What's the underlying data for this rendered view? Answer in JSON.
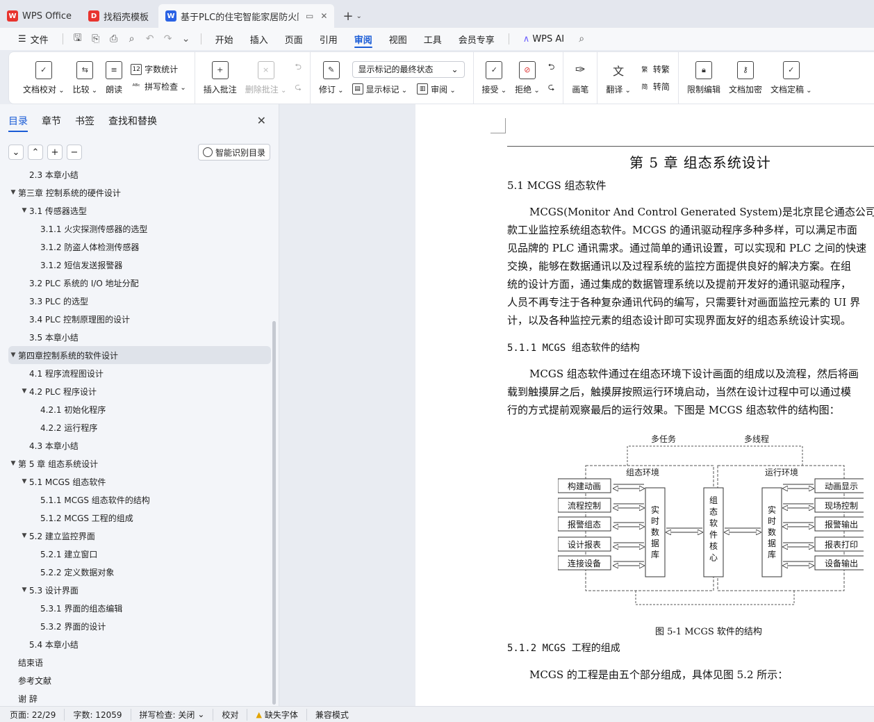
{
  "tabs": [
    {
      "label": "WPS Office",
      "icon": "wps-logo-icon",
      "color": "#e8342e"
    },
    {
      "label": "找稻壳模板",
      "icon": "docer-logo-icon",
      "color": "#e8342e"
    },
    {
      "label": "基于PLC的住宅智能家居防火防",
      "icon": "writer-logo-icon",
      "color": "#2a62e4"
    }
  ],
  "menu": {
    "file": "文件",
    "items": [
      "开始",
      "插入",
      "页面",
      "引用",
      "审阅",
      "视图",
      "工具",
      "会员专享"
    ],
    "active": "审阅",
    "wps_ai": "WPS AI"
  },
  "ribbon": {
    "doc_check": "文档校对",
    "compare": "比较",
    "read_aloud": "朗读",
    "word_count": "字数统计",
    "spell_check": "拼写检查",
    "insert_comment": "插入批注",
    "delete_comment": "删除批注",
    "revise": "修订",
    "markup_state": "显示标记的最终状态",
    "show_markup": "显示标记",
    "review": "审阅",
    "accept": "接受",
    "reject": "拒绝",
    "pen": "画笔",
    "translate": "翻译",
    "to_traditional": "转繁",
    "to_simplified": "转简",
    "restrict_edit": "限制编辑",
    "encrypt": "文档加密",
    "finalize": "文档定稿"
  },
  "sidebar": {
    "tabs": [
      "目录",
      "章节",
      "书签",
      "查找和替换"
    ],
    "active_tab": "目录",
    "smart_toc": "智能识别目录",
    "toc": [
      {
        "text": "2.3   本章小结",
        "level": 2,
        "arrow": ""
      },
      {
        "text": "第三章   控制系统的硬件设计",
        "level": 1,
        "arrow": "▼"
      },
      {
        "text": "3.1    传感器选型",
        "level": 2,
        "arrow": "▼"
      },
      {
        "text": "3.1.1    火灾探测传感器的选型",
        "level": 3,
        "arrow": ""
      },
      {
        "text": "3.1.2    防盗人体检测传感器",
        "level": 3,
        "arrow": ""
      },
      {
        "text": "3.1.2    短信发送报警器",
        "level": 3,
        "arrow": ""
      },
      {
        "text": "3.2    PLC 系统的 I/O 地址分配",
        "level": 2,
        "arrow": ""
      },
      {
        "text": "3.3    PLC 的选型",
        "level": 2,
        "arrow": ""
      },
      {
        "text": "3.4    PLC 控制原理图的设计",
        "level": 2,
        "arrow": ""
      },
      {
        "text": "3.5    本章小结",
        "level": 2,
        "arrow": ""
      },
      {
        "text": "第四章控制系统的软件设计",
        "level": 1,
        "arrow": "▼",
        "selected": true
      },
      {
        "text": "4.1  程序流程图设计",
        "level": 2,
        "arrow": ""
      },
      {
        "text": "4.2 PLC 程序设计",
        "level": 2,
        "arrow": "▼"
      },
      {
        "text": "4.2.1  初始化程序",
        "level": 3,
        "arrow": ""
      },
      {
        "text": "4.2.2  运行程序",
        "level": 3,
        "arrow": ""
      },
      {
        "text": "4.3    本章小结",
        "level": 2,
        "arrow": ""
      },
      {
        "text": "第 5 章    组态系统设计",
        "level": 1,
        "arrow": "▼"
      },
      {
        "text": "5.1    MCGS 组态软件",
        "level": 2,
        "arrow": "▼"
      },
      {
        "text": "5.1.1 MCGS 组态软件的结构",
        "level": 3,
        "arrow": ""
      },
      {
        "text": "5.1.2 MCGS 工程的组成",
        "level": 3,
        "arrow": ""
      },
      {
        "text": "5.2    建立监控界面",
        "level": 2,
        "arrow": "▼"
      },
      {
        "text": "5.2.1    建立窗口",
        "level": 3,
        "arrow": ""
      },
      {
        "text": "5.2.2    定义数据对象",
        "level": 3,
        "arrow": ""
      },
      {
        "text": "5.3    设计界面",
        "level": 2,
        "arrow": "▼"
      },
      {
        "text": "5.3.1    界面的组态编辑",
        "level": 3,
        "arrow": ""
      },
      {
        "text": "5.3.2  界面的设计",
        "level": 3,
        "arrow": ""
      },
      {
        "text": "5.4    本章小结",
        "level": 2,
        "arrow": ""
      },
      {
        "text": "结束语",
        "level": 1,
        "arrow": ""
      },
      {
        "text": "参考文献",
        "level": 1,
        "arrow": ""
      },
      {
        "text": "谢    辞",
        "level": 1,
        "arrow": ""
      }
    ]
  },
  "document": {
    "chapter_title": "第 5 章    组态系统设计",
    "h_5_1": "5.1   MCGS 组态软件",
    "para1": [
      "MCGS(Monitor And Control Generated System)是北京昆仑通态公司出品",
      "款工业监控系统组态软件。MCGS 的通讯驱动程序多种多样，可以满足市面",
      "见品牌的 PLC 通讯需求。通过简单的通讯设置，可以实现和 PLC 之间的快速",
      "交换，能够在数据通讯以及过程系统的监控方面提供良好的解决方案。在组",
      "统的设计方面，通过集成的数据管理系统以及提前开发好的通讯驱动程序，",
      "人员不再专注于各种复杂通讯代码的编写，只需要针对画面监控元素的 UI 界",
      "计，以及各种监控元素的组态设计即可实现界面友好的组态系统设计实现。"
    ],
    "h_5_1_1": "5.1.1 MCGS 组态软件的结构",
    "para2": [
      "MCGS 组态软件通过在组态环境下设计画面的组成以及流程，然后将画",
      "载到触摸屏之后，触摸屏按照运行环境启动，当然在设计过程中可以通过模",
      "行的方式提前观察最后的运行效果。下图是 MCGS 组态软件的结构图："
    ],
    "diagram": {
      "multi_task": "多任务",
      "multi_thread": "多线程",
      "config_env": "组态环境",
      "run_env": "运行环境",
      "left_items": [
        "构建动画",
        "流程控制",
        "报警组态",
        "设计报表",
        "连接设备"
      ],
      "right_items": [
        "动画显示",
        "现场控制",
        "报警输出",
        "报表打印",
        "设备输出"
      ],
      "realtime_db": "实时数据库",
      "core": "组态软件核心"
    },
    "caption": "图 5-1  MCGS 软件的结构",
    "h_5_1_2": "5.1.2 MCGS 工程的组成",
    "para3": "MCGS 的工程是由五个部分组成，具体见图 5.2 所示："
  },
  "status": {
    "page": "页面: 22/29",
    "words": "字数: 12059",
    "spell": "拼写检查: 关闭",
    "proof": "校对",
    "missing_font": "缺失字体",
    "compat": "兼容模式"
  }
}
